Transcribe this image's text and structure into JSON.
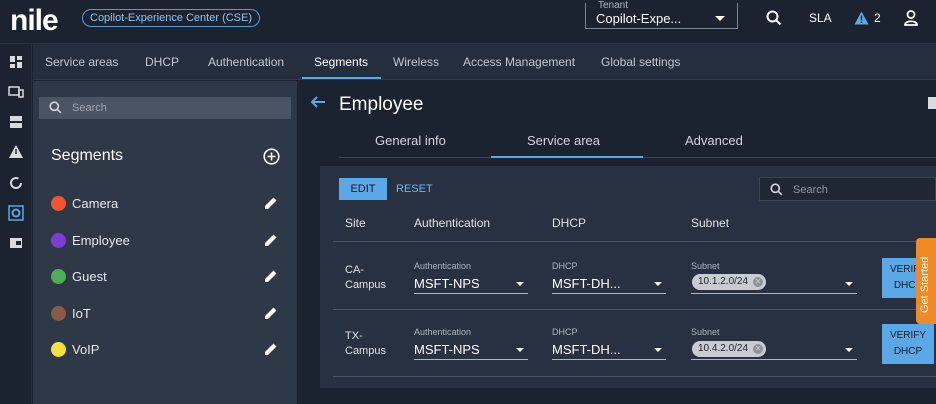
{
  "app": {
    "logo": "nile",
    "org_badge": "Copilot-Experience Center (CSE)",
    "tenant_label": "Tenant",
    "tenant_value": "Copilot-Expe...",
    "sla_label": "SLA",
    "alert_count": "2"
  },
  "nav": {
    "tabs": [
      {
        "label": "Service areas"
      },
      {
        "label": "DHCP"
      },
      {
        "label": "Authentication"
      },
      {
        "label": "Segments"
      },
      {
        "label": "Wireless"
      },
      {
        "label": "Access Management"
      },
      {
        "label": "Global settings"
      }
    ]
  },
  "sidebar": {
    "search_placeholder": "Search",
    "title": "Segments",
    "items": [
      {
        "label": "Camera",
        "color": "#f2552c"
      },
      {
        "label": "Employee",
        "color": "#7b3fd6"
      },
      {
        "label": "Guest",
        "color": "#4caf50"
      },
      {
        "label": "IoT",
        "color": "#8a5a44"
      },
      {
        "label": "VoIP",
        "color": "#f4e23a"
      }
    ]
  },
  "main": {
    "title": "Employee",
    "tabs": [
      {
        "label": "General info"
      },
      {
        "label": "Service area"
      },
      {
        "label": "Advanced"
      }
    ],
    "edit_label": "EDIT",
    "reset_label": "RESET",
    "search_placeholder": "Search",
    "columns": [
      "Site",
      "Authentication",
      "DHCP",
      "Subnet"
    ],
    "rows": [
      {
        "site": "CA-\nCampus",
        "auth_label": "Authentication",
        "auth_value": "MSFT-NPS",
        "dhcp_label": "DHCP",
        "dhcp_value": "MSFT-DH...",
        "subnet_label": "Subnet",
        "subnet_chip": "10.1.2.0/24",
        "verify_label": "VERIFY\nDHCP"
      },
      {
        "site": "TX-\nCampus",
        "auth_label": "Authentication",
        "auth_value": "MSFT-NPS",
        "dhcp_label": "DHCP",
        "dhcp_value": "MSFT-DH...",
        "subnet_label": "Subnet",
        "subnet_chip": "10.4.2.0/24",
        "verify_label": "VERIFY\nDHCP"
      }
    ]
  },
  "widget": {
    "get_started": "Get Started"
  },
  "colors": {
    "accent": "#5aa9e6",
    "warning": "#5aa9e6",
    "get_started": "#f08a24"
  }
}
